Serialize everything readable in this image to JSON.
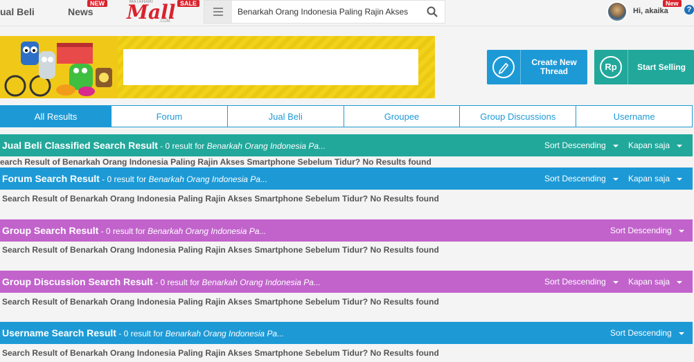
{
  "topbar": {
    "nav_jual_beli": "ual Beli",
    "nav_news": "News",
    "news_badge": "NEW",
    "logo_small": "MATAHARI",
    "logo_main": "Mall",
    "logo_com": ".COM",
    "sale_badge": "SALE",
    "search_value": "Benarkah Orang Indonesia Paling Rajin Akses",
    "greeting": "Hi, akaika",
    "new_badge": "New",
    "help": "?"
  },
  "actions": {
    "create_label": "Create New Thread",
    "sell_label": "Start Selling",
    "rp": "Rp"
  },
  "tabs": [
    "All Results",
    "Forum",
    "Jual Beli",
    "Groupee",
    "Group Discussions",
    "Username"
  ],
  "sections": [
    {
      "title": "Jual Beli Classified Search Result",
      "count": " - 0 result for ",
      "query": "Benarkah Orang Indonesia Pa...",
      "sort": "Sort Descending",
      "time": "Kapan saja",
      "message": "earch Result of Benarkah Orang Indonesia Paling Rajin Akses Smartphone Sebelum Tidur? No Results found",
      "color": "#21a89b"
    },
    {
      "title": "Forum Search Result",
      "count": " - 0 result for ",
      "query": "Benarkah Orang Indonesia Pa...",
      "sort": "Sort Descending",
      "time": "Kapan saja",
      "message": "Search Result of Benarkah Orang Indonesia Paling Rajin Akses Smartphone Sebelum Tidur? No Results found",
      "color": "#1d9ad6"
    },
    {
      "title": "Group Search Result",
      "count": " - 0 result for ",
      "query": "Benarkah Orang Indonesia Pa...",
      "sort": "Sort Descending",
      "message": "Search Result of Benarkah Orang Indonesia Paling Rajin Akses Smartphone Sebelum Tidur? No Results found",
      "color": "#c263cc"
    },
    {
      "title": "Group Discussion Search Result",
      "count": " - 0 result for ",
      "query": "Benarkah Orang Indonesia Pa...",
      "sort": "Sort Descending",
      "time": "Kapan saja",
      "message": "Search Result of Benarkah Orang Indonesia Paling Rajin Akses Smartphone Sebelum Tidur? No Results found",
      "color": "#c263cc"
    },
    {
      "title": "Username Search Result",
      "count": " - 0 result for ",
      "query": "Benarkah Orang Indonesia Pa...",
      "sort": "Sort Descending",
      "message": "Search Result of Benarkah Orang Indonesia Paling Rajin Akses Smartphone Sebelum Tidur? No Results found",
      "color": "#1d9ad6"
    }
  ]
}
